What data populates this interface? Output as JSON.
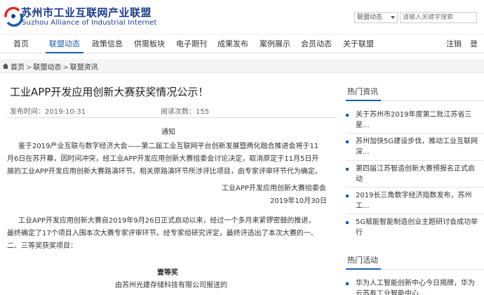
{
  "header": {
    "brand_cn": "苏州市工业互联网产业联盟",
    "brand_en": "Suzhou Alliance of Industrial Internet",
    "search_scope": "联盟动态",
    "search_placeholder": "请输入关键字搜索"
  },
  "nav": {
    "items": [
      "首页",
      "联盟动态",
      "政策信息",
      "供需板块",
      "电子期刊",
      "成果发布",
      "案例展示",
      "会员动态",
      "关于联盟"
    ],
    "active": "联盟动态",
    "logout": "注销",
    "login": "登录"
  },
  "breadcrumb": [
    "首页",
    "联盟动态",
    "联盟资讯"
  ],
  "article": {
    "title": "工业APP开发应用创新大赛获奖情况公示！",
    "publish_label": "发布时间：",
    "publish_date": "2019-10-31",
    "views_label": "阅读次数：",
    "views": "155",
    "notice_heading": "通知",
    "notice_lines": [
      "鉴于2019产业互联与数字经济大会——第二届工业互联网平台创新发展暨两化融合推进会将于11",
      "月6日在苏开幕，因时间冲突，经工业APP开发应用创新大赛组委会讨论决定，取消原定于11月5日开",
      "展的工业APP开发应用创新大赛路演环节。相关原路演环节所涉评比项目，由专家评审环节代为确定。"
    ],
    "signature_org": "工业APP开发应用创新大赛组委会",
    "signature_date": "2019年10月30日",
    "body_lines": [
      "工业APP开发应用创新大赛自2019年9月26日正式启动以来，经过一个多月来紧锣密鼓的推进，",
      "最终确定了17个项目入围本次大赛专家评审环节。经专家组研究评定，最终评选出了本次大赛的一、",
      "二、三等奖获奖项目："
    ],
    "first_prize": "壹等奖",
    "first_prize_line": "由苏州光建存储科技有限公司报送的"
  },
  "sidebar": {
    "hot_news_title": "热门资讯",
    "hot_news": [
      [
        "关于苏州市2019年度第二批江苏省三",
        "星..."
      ],
      [
        "苏州加快5G建设步伐，推动工业互联网",
        "深..."
      ],
      [
        "第四届江苏智造创新大赛预报名正式启",
        "动"
      ],
      [
        "2019长三角数字经济指数发布，苏州",
        "工..."
      ],
      [
        "5G赋能智能制造创业主题研讨会成功举",
        "行"
      ]
    ],
    "hot_events_title": "热门活动",
    "hot_events": [
      [
        "华为人工智能创新中心今日揭牌，华为",
        "云苏有工业智能中心..."
      ]
    ]
  },
  "colors": {
    "brand": "#1a3b8c",
    "accent": "#1a5fb4"
  }
}
